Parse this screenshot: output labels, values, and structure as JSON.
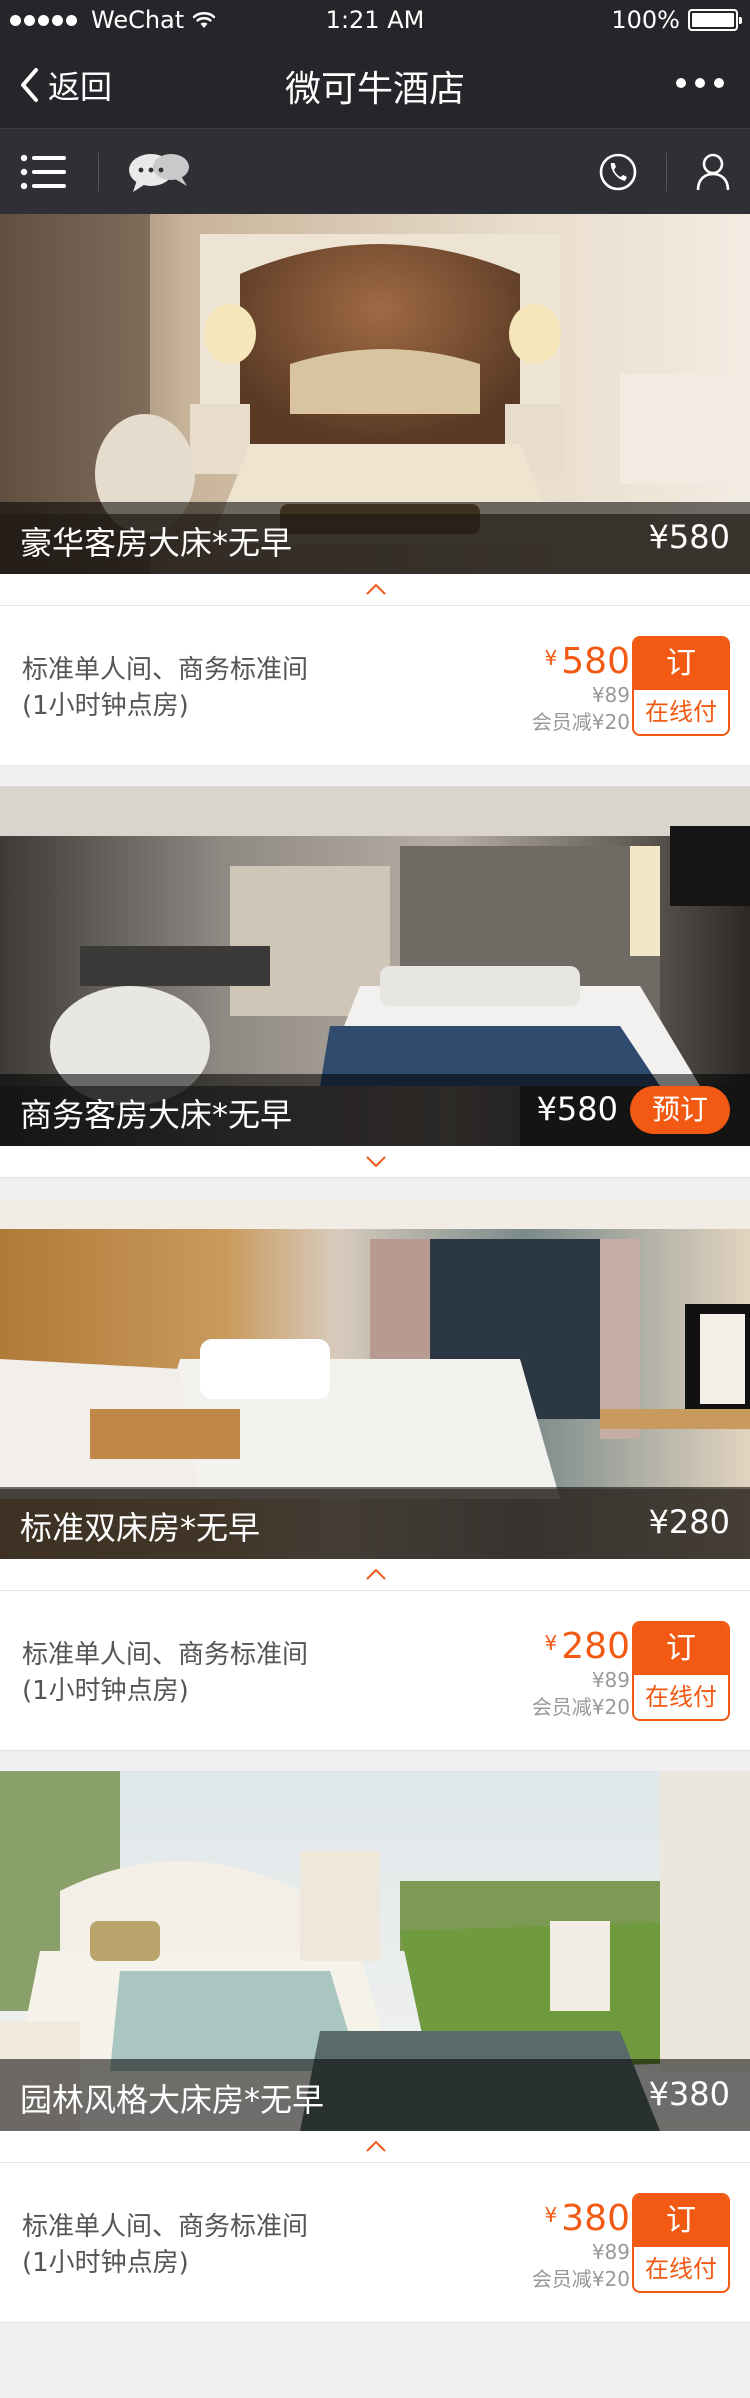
{
  "status": {
    "carrier": "WeChat",
    "time": "1:21 AM",
    "battery": "100%"
  },
  "nav": {
    "back_label": "返回",
    "title": "微可牛酒店"
  },
  "toolbar": {
    "icons": [
      "menu-list-icon",
      "chat-bubbles-icon",
      "phone-icon",
      "user-icon"
    ]
  },
  "rooms": [
    {
      "name": "豪华客房大床*无早",
      "photo_price": "¥580",
      "expanded": true,
      "desc_line1": "标准单人间、商务标准间",
      "desc_line2": "(1小时钟点房)",
      "currency": "¥",
      "price": "580",
      "orig_price": "¥89",
      "member_note": "会员减¥20",
      "order_top": "订",
      "order_bottom": "在线付"
    },
    {
      "name": "商务客房大床*无早",
      "photo_price": "¥580",
      "expanded": false,
      "book_label": "预订"
    },
    {
      "name": "标准双床房*无早",
      "photo_price": "¥280",
      "expanded": true,
      "desc_line1": "标准单人间、商务标准间",
      "desc_line2": "(1小时钟点房)",
      "currency": "¥",
      "price": "280",
      "orig_price": "¥89",
      "member_note": "会员减¥20",
      "order_top": "订",
      "order_bottom": "在线付"
    },
    {
      "name": "园林风格大床房*无早",
      "photo_price": "¥380",
      "expanded": true,
      "desc_line1": "标准单人间、商务标准间",
      "desc_line2": "(1小时钟点房)",
      "currency": "¥",
      "price": "380",
      "orig_price": "¥89",
      "member_note": "会员减¥20",
      "order_top": "订",
      "order_bottom": "在线付"
    }
  ],
  "colors": {
    "accent": "#f25a14",
    "header": "#25262a",
    "toolbar": "#2f3035",
    "page_bg": "#f0f0f0"
  }
}
